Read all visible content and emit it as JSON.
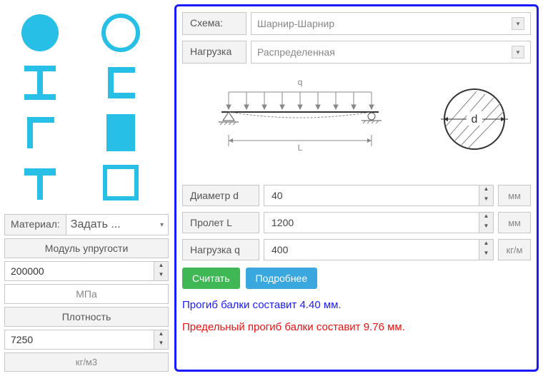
{
  "left": {
    "material_label": "Материал:",
    "material_value": "Задать ...",
    "modulus_label": "Модуль упругости",
    "modulus_value": "200000",
    "modulus_unit": "МПа",
    "density_label": "Плотность",
    "density_value": "7250",
    "density_unit": "кг/м3"
  },
  "right": {
    "schema_label": "Схема:",
    "schema_value": "Шарнир-Шарнир",
    "load_label": "Нагрузка",
    "load_value": "Распределенная",
    "diag_q": "q",
    "diag_L": "L",
    "diag_d": "d",
    "diameter_label": "Диаметр d",
    "diameter_value": "40",
    "diameter_unit": "мм",
    "span_label": "Пролет L",
    "span_value": "1200",
    "span_unit": "мм",
    "loadq_label": "Нагрузка q",
    "loadq_value": "400",
    "loadq_unit": "кг/м",
    "calc_btn": "Считать",
    "more_btn": "Подробнее",
    "result1": "Прогиб балки составит 4.40 мм.",
    "result2": "Предельный прогиб балки составит 9.76 мм."
  }
}
